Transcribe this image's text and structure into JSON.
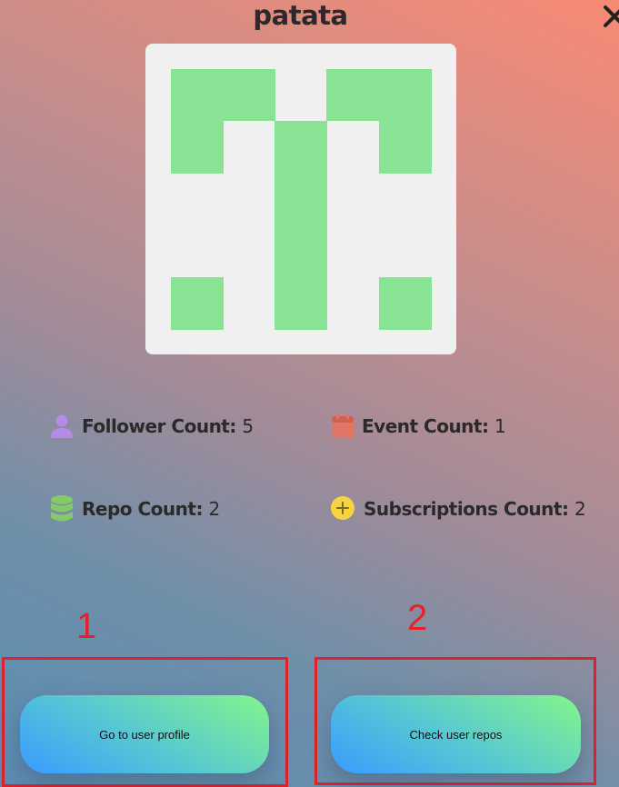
{
  "user": {
    "name": "patata"
  },
  "avatar": {
    "icon": "identicon",
    "fill_color": "#88e395",
    "background_color": "#f0f0f0"
  },
  "stats": {
    "followers": {
      "label": "Follower Count",
      "separator": ":",
      "value": "5",
      "icon": "user-icon",
      "color": "#b48be6"
    },
    "events": {
      "label": "Event Count",
      "separator": ":",
      "value": "1",
      "icon": "calendar-icon",
      "color": "#e07565"
    },
    "repos": {
      "label": "Repo Count",
      "separator": ":",
      "value": "2",
      "icon": "database-icon",
      "color": "#86c96a"
    },
    "subscriptions": {
      "label": "Subscriptions Count",
      "separator": ":",
      "value": "2",
      "icon": "plus-circle-icon",
      "color": "#f5d341"
    }
  },
  "annotations": {
    "marker_1": "1",
    "marker_2": "2",
    "highlight_color": "#e0202a"
  },
  "actions": {
    "profile_button": "Go to user profile",
    "repos_button": "Check user repos"
  }
}
